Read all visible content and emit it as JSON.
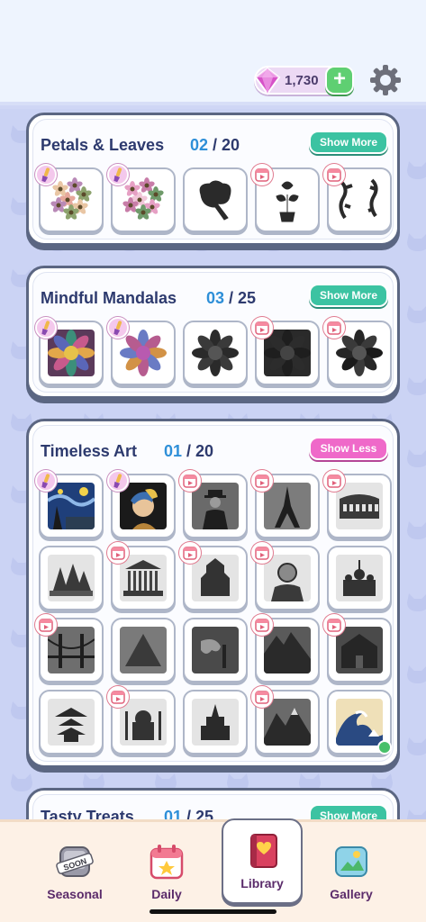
{
  "header": {
    "gems": "1,730",
    "plus_label": "+"
  },
  "sections": [
    {
      "title": "Petals & Leaves",
      "current": "02",
      "separator": " / ",
      "total": "20",
      "button": "Show More",
      "items": [
        "brush",
        "brush",
        "none",
        "cal",
        "cal"
      ],
      "arts": [
        "flower-bouquet-color",
        "flower-bouquet-pink",
        "black-tree",
        "black-potted-plant",
        "black-vines"
      ]
    },
    {
      "title": "Mindful Mandalas",
      "current": "03",
      "separator": " / ",
      "total": "25",
      "button": "Show More",
      "items": [
        "brush",
        "brush",
        "none",
        "cal",
        "cal"
      ],
      "arts": [
        "mandala-color-1",
        "mandala-color-2",
        "mandala-black-1",
        "mandala-black-2",
        "mandala-black-3"
      ]
    },
    {
      "title": "Timeless Art",
      "current": "01",
      "separator": " / ",
      "total": "20",
      "button": "Show Less",
      "items": [
        "brush",
        "brush",
        "cal",
        "cal",
        "cal",
        "none",
        "cal",
        "cal",
        "cal",
        "none",
        "cal",
        "none",
        "none",
        "cal",
        "cal",
        "none",
        "cal",
        "none",
        "cal",
        "none"
      ],
      "arts": [
        "starry-night",
        "pearl-earring-girl",
        "man-in-hat",
        "eiffel-tower",
        "colosseum",
        "opera-house",
        "greek-temple",
        "asian-temple",
        "portrait-man",
        "kremlin",
        "golden-gate-bridge",
        "pyramid",
        "melting-clocks",
        "machu-picchu",
        "mansion",
        "pagoda",
        "taj-mahal",
        "castle",
        "mountains",
        "great-wave"
      ]
    },
    {
      "title": "Tasty Treats",
      "current": "01",
      "separator": " / ",
      "total": "25",
      "button": "Show More"
    }
  ],
  "nav": [
    {
      "label": "Seasonal",
      "icon": "soon-badge-icon",
      "badge": "SOON"
    },
    {
      "label": "Daily",
      "icon": "calendar-icon"
    },
    {
      "label": "Library",
      "icon": "book-icon"
    },
    {
      "label": "Gallery",
      "icon": "gallery-icon"
    }
  ],
  "colors": {
    "accent_blue": "#2e8fd8",
    "title_navy": "#2d3a6e",
    "show_more": "#3cc3a2",
    "show_less": "#ef69c9",
    "nav_label": "#5a2b6a"
  }
}
